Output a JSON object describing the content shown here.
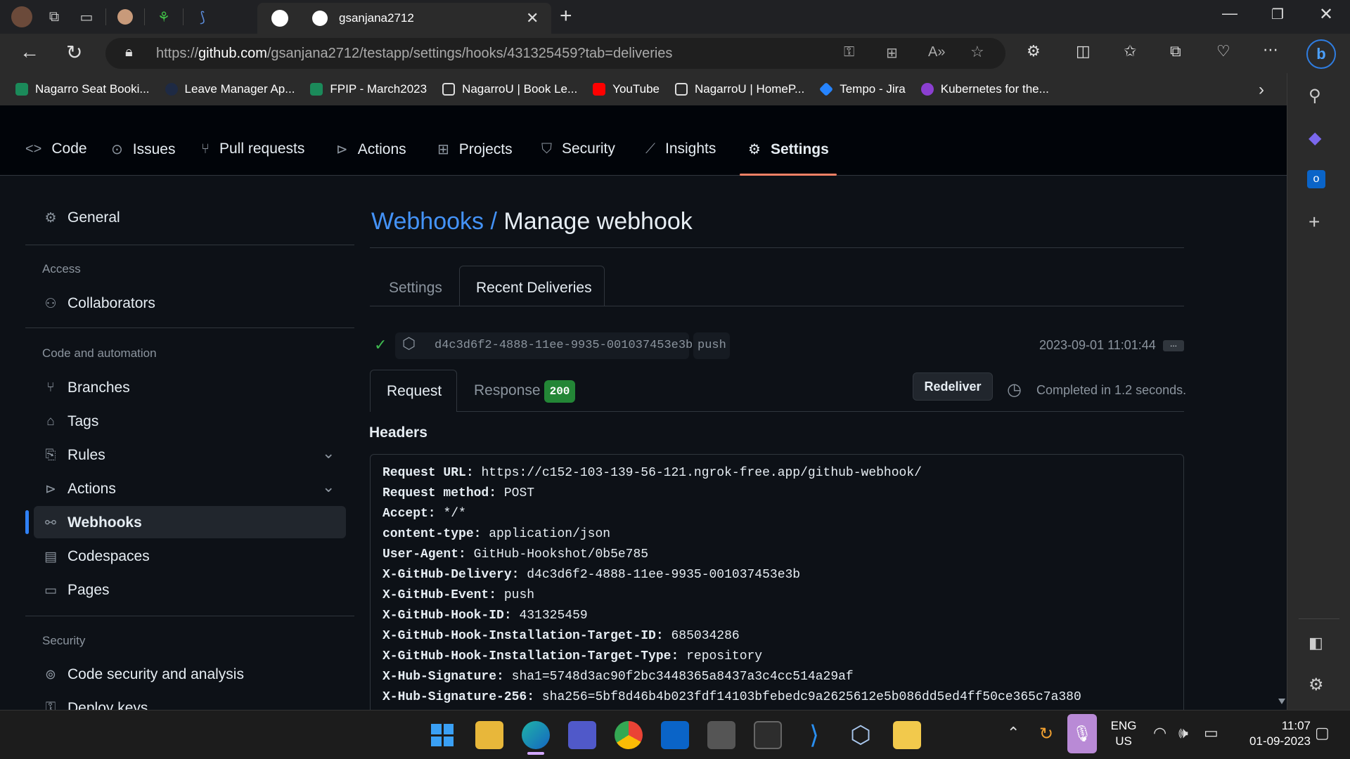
{
  "browser": {
    "active_tab_title": "gsanjana2712",
    "url_prefix": "https://",
    "url_host": "github.com",
    "url_path": "/gsanjana2712/testapp/settings/hooks/431325459?tab=deliveries",
    "bookmarks": [
      {
        "label": "Nagarro Seat Booki...",
        "color": "#1b8a5a"
      },
      {
        "label": "Leave Manager Ap...",
        "color": "#1e2a44"
      },
      {
        "label": "FPIP - March2023",
        "color": "#1b8a5a"
      },
      {
        "label": "NagarroU | Book Le...",
        "color": "#2b2b2b"
      },
      {
        "label": "YouTube",
        "color": "#ff0000"
      },
      {
        "label": "NagarroU | HomeP...",
        "color": "#2b2b2b"
      },
      {
        "label": "Tempo - Jira",
        "color": "#2684ff"
      },
      {
        "label": "Kubernetes for the...",
        "color": "#8b3fd1"
      }
    ]
  },
  "repo_nav": {
    "items": [
      {
        "label": "Code",
        "icon": "code-icon"
      },
      {
        "label": "Issues",
        "icon": "issue-icon"
      },
      {
        "label": "Pull requests",
        "icon": "pull-request-icon"
      },
      {
        "label": "Actions",
        "icon": "play-icon"
      },
      {
        "label": "Projects",
        "icon": "table-icon"
      },
      {
        "label": "Security",
        "icon": "shield-icon"
      },
      {
        "label": "Insights",
        "icon": "graph-icon"
      },
      {
        "label": "Settings",
        "icon": "gear-icon"
      }
    ],
    "active": "Settings"
  },
  "sidebar": {
    "general": "General",
    "access_heading": "Access",
    "collaborators": "Collaborators",
    "code_heading": "Code and automation",
    "branches": "Branches",
    "tags": "Tags",
    "rules": "Rules",
    "actions": "Actions",
    "webhooks": "Webhooks",
    "codespaces": "Codespaces",
    "pages": "Pages",
    "security_heading": "Security",
    "code_security": "Code security and analysis",
    "deploy_keys": "Deploy keys"
  },
  "main": {
    "breadcrumb_link": "Webhooks /",
    "title": "Manage webhook",
    "tabs": [
      "Settings",
      "Recent Deliveries"
    ],
    "active_tab": "Recent Deliveries",
    "delivery": {
      "guid": "d4c3d6f2-4888-11ee-9935-001037453e3b",
      "event": "push",
      "timestamp": "2023-09-01 11:01:44",
      "more": "..."
    },
    "subtabs": {
      "request": "Request",
      "response": "Response",
      "status_code": "200"
    },
    "redeliver": "Redeliver",
    "completed": "Completed in 1.2 seconds.",
    "headers_title": "Headers",
    "headers": [
      {
        "k": "Request URL:",
        "v": "https://c152-103-139-56-121.ngrok-free.app/github-webhook/"
      },
      {
        "k": "Request method:",
        "v": "POST"
      },
      {
        "k": "Accept:",
        "v": "*/*"
      },
      {
        "k": "content-type:",
        "v": "application/json"
      },
      {
        "k": "User-Agent:",
        "v": "GitHub-Hookshot/0b5e785"
      },
      {
        "k": "X-GitHub-Delivery:",
        "v": "d4c3d6f2-4888-11ee-9935-001037453e3b"
      },
      {
        "k": "X-GitHub-Event:",
        "v": "push"
      },
      {
        "k": "X-GitHub-Hook-ID:",
        "v": "431325459"
      },
      {
        "k": "X-GitHub-Hook-Installation-Target-ID:",
        "v": "685034286"
      },
      {
        "k": "X-GitHub-Hook-Installation-Target-Type:",
        "v": "repository"
      },
      {
        "k": "X-Hub-Signature:",
        "v": "sha1=5748d3ac90f2bc3448365a8437a3c4cc514a29af"
      },
      {
        "k": "X-Hub-Signature-256:",
        "v": "sha256=5bf8d46b4b023fdf14103bfebedc9a2625612e5b086dd5ed4ff50ce365c7a380"
      }
    ]
  },
  "taskbar": {
    "lang": "ENG",
    "region": "US",
    "time": "11:07",
    "date": "01-09-2023"
  },
  "colors": {
    "link": "#4493f8",
    "accent_underline": "#f78166",
    "success": "#3fb950",
    "badge_green": "#238636"
  }
}
